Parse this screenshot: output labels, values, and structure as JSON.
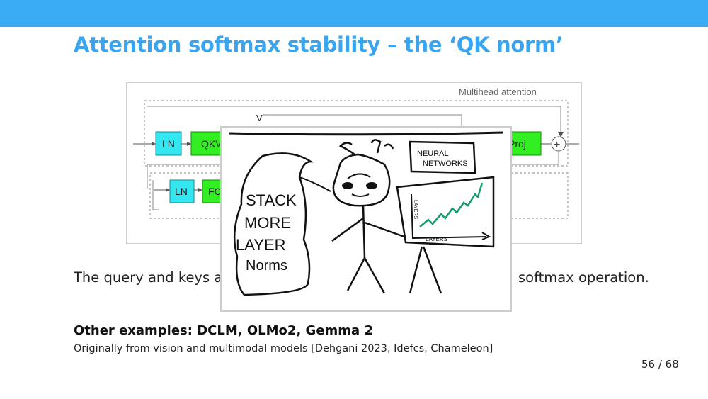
{
  "slide": {
    "title": "Attention softmax stability – the ‘QK norm’",
    "body_left": "The query and keys ar",
    "body_right": "softmax operation.",
    "examples_heading": "Other examples: DCLM, OLMo2, Gemma 2",
    "origin_note": "Originally from vision and multimodal models [Dehgani 2023, Idefcs, Chameleon]",
    "page_number": "56 / 68"
  },
  "diagram": {
    "label_multihead": "Multihead attention",
    "label_v": "V",
    "block_ln_1": "LN",
    "block_qkv": "QKV",
    "block_proj": "Proj",
    "block_ln_2": "LN",
    "block_fc": "FC",
    "plus_symbol": "+",
    "colors": {
      "ln": "#33e6f0",
      "green": "#33ee22",
      "dashed": "#888888"
    }
  },
  "meme": {
    "bubble_lines": [
      "STACK",
      "MORE",
      "LAYER",
      "Norms"
    ],
    "sign_line1": "NEURAL",
    "sign_line2": "NETWORKS",
    "chart_x_label": "LAYERS",
    "chart_y_label": "LAYERS",
    "line_color": "#1a9a6a"
  }
}
